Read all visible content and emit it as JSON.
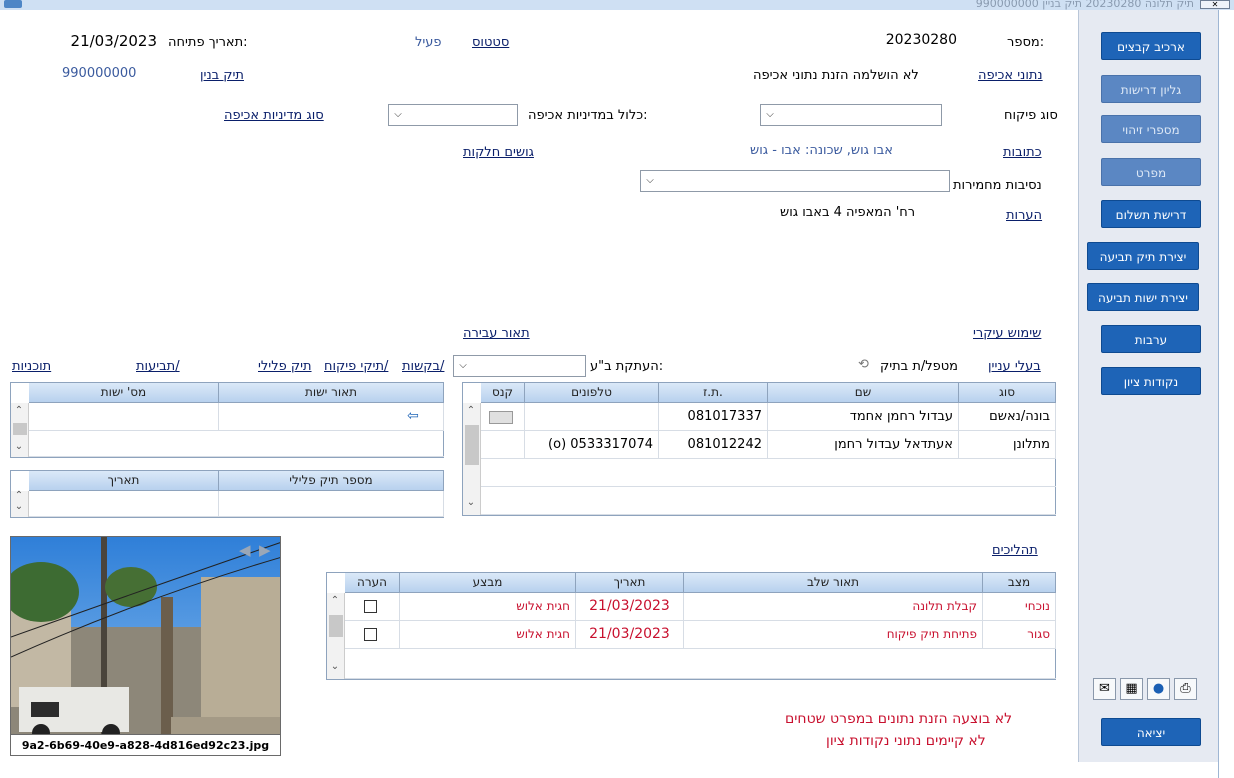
{
  "window": {
    "title": "תיק תלונה 20230280  תיק בניין 990000000"
  },
  "sidebar": {
    "buttons": [
      "ארכיב קבצים",
      "גליון דרישות",
      "מספרי זיהוי",
      "מפרט",
      "דרישת תשלום",
      "יצירת תיק תביעה",
      "יצירת ישות תביעה",
      "ערבות",
      "נקודות ציון"
    ],
    "exit": "יציאה",
    "tools": [
      "printer-icon",
      "globe-icon",
      "map-icon",
      "mail-icon"
    ]
  },
  "form": {
    "number_label": "מספר:",
    "number_value": "20230280",
    "status_label": "סטטוס",
    "status_value": "פעיל",
    "open_date_label": "תאריך פתיחה:",
    "open_date_value": "21/03/2023",
    "enforcement_data_label": "נתוני אכיפה",
    "enforcement_data_value": "לא הושלמה הזנת נתוני אכיפה",
    "building_file_label": "תיק בנין",
    "building_file_value": "990000000",
    "supervision_type_label": "סוג פיקוח",
    "in_policy_label": "כלול במדיניות אכיפה:",
    "policy_type_label": "סוג מדיניות אכיפה",
    "addresses_label": "כתובות",
    "addresses_value": "אבו גוש, שכונה: אבו - גוש",
    "blocks_label": "גושים חלקות",
    "aggravating_label": "נסיבות מחמירות",
    "notes_label": "הערות",
    "notes_value": "רח' המאפיה 4 באבו גוש",
    "main_use_label": "שימוש עיקרי",
    "offense_desc_label": "תאור עבירה"
  },
  "links_row": {
    "stakeholders": "בעלי עניין",
    "handler": "מטפל/ת בתיק",
    "copy_label": "העתקת ב\"ע:",
    "requests": "בקשות/",
    "enforcement_files": "תיקי פיקוח/",
    "criminal_file": "תיק פלילי",
    "claims": "תביעות/",
    "plans": "תוכניות"
  },
  "parties": {
    "headers": [
      "סוג",
      "שם",
      "ת.ז.",
      "טלפונים",
      "קנס"
    ],
    "rows": [
      {
        "type": "בונה/נאשם",
        "name": "עבדול רחמן אחמד",
        "id": "081017337",
        "phone": ""
      },
      {
        "type": "מתלונן",
        "name": "אעתדאל עבדול רחמן",
        "id": "081012242",
        "phone": "(o) 0533317074"
      }
    ]
  },
  "entities": {
    "headers": [
      "תאור ישות",
      "מס' ישות"
    ]
  },
  "criminal": {
    "headers": [
      "מספר תיק פלילי",
      "תאריך"
    ]
  },
  "processes": {
    "title": "תהליכים",
    "headers": [
      "מצב",
      "תאור שלב",
      "תאריך",
      "מבצע",
      "הערה"
    ],
    "rows": [
      {
        "state": "נוכחי",
        "stage": "קבלת תלונה",
        "date": "21/03/2023",
        "by": "חגית אלוש"
      },
      {
        "state": "סגור",
        "stage": "פתיחת תיק פיקוח",
        "date": "21/03/2023",
        "by": "חגית אלוש"
      }
    ]
  },
  "photo": {
    "filename": "9a2-6b69-40e9-a828-4d816ed92c23.jpg"
  },
  "messages": [
    "לא בוצעה הזנת נתונים במפרט שטחים",
    "לא קיימים נתוני נקודות ציון"
  ]
}
